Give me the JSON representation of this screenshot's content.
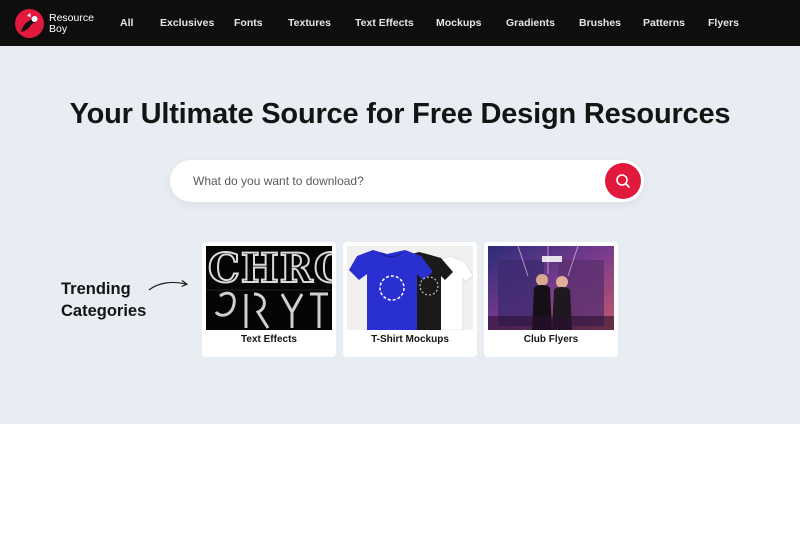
{
  "header": {
    "logo_line1": "Resource",
    "logo_line2": "Boy",
    "nav": [
      {
        "label": "All"
      },
      {
        "label": "Exclusives"
      },
      {
        "label": "Fonts"
      },
      {
        "label": "Textures"
      },
      {
        "label": "Text Effects"
      },
      {
        "label": "Mockups"
      },
      {
        "label": "Gradients"
      },
      {
        "label": "Brushes"
      },
      {
        "label": "Patterns"
      },
      {
        "label": "Flyers"
      }
    ]
  },
  "hero": {
    "title": "Your Ultimate Source for Free Design Resources",
    "search": {
      "placeholder": "What do you want to download?",
      "value": ""
    }
  },
  "trending": {
    "line1": "Trending",
    "line2": "Categories",
    "cards": [
      {
        "label": "Text Effects",
        "image_text": "CHRO"
      },
      {
        "label": "T-Shirt Mockups"
      },
      {
        "label": "Club Flyers"
      }
    ]
  },
  "colors": {
    "accent": "#e1193c",
    "topbar": "#0e0e0e",
    "hero_bg": "#e8edf3"
  },
  "icons": {
    "logo": "resource-boy-logo",
    "search": "magnifier-icon",
    "arrow": "curved-arrow-icon"
  }
}
